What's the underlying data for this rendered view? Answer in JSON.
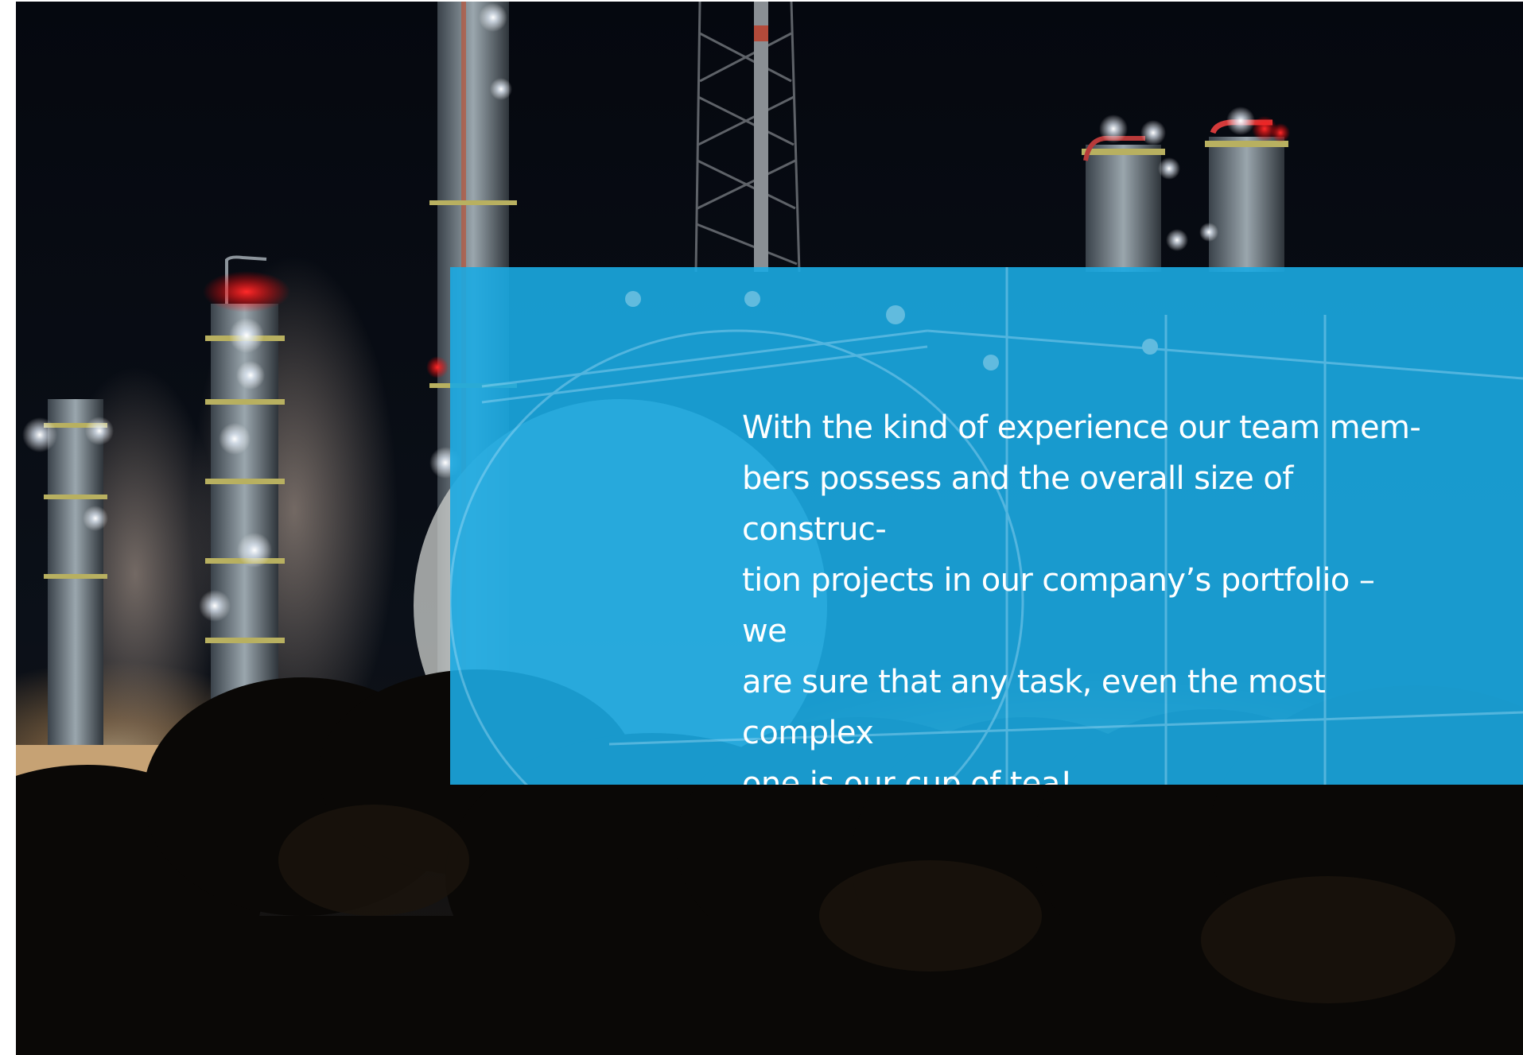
{
  "hero": {
    "background_image": "night-refinery-photo",
    "overlay_color": "#1baae2",
    "text": "With the kind of experience our team mem-\nbers possess and the overall size of construc-\ntion projects in our company’s portfolio – we\nare sure that any task, even the most complex\none is our cup of tea!"
  }
}
